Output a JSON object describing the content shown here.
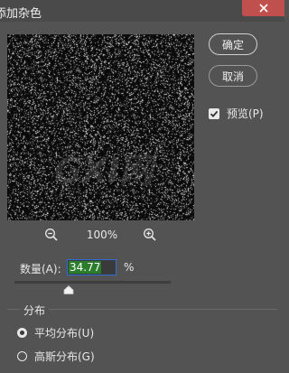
{
  "title": "添加杂色",
  "buttons": {
    "ok": "确定",
    "cancel": "取消"
  },
  "preview_toggle": {
    "label": "预览(P)",
    "checked": true
  },
  "zoom": {
    "level": "100%"
  },
  "amount": {
    "label": "数量(A):",
    "value": "34.77",
    "unit": "%",
    "slider_fraction": 0.3477
  },
  "distribution": {
    "title": "分布",
    "options": [
      {
        "label": "平均分布(U)",
        "selected": true
      },
      {
        "label": "高斯分布(G)",
        "selected": false
      }
    ]
  },
  "watermark": "GXI网",
  "colors": {
    "dialog_bg": "#535353",
    "close_button": "#c0504d",
    "input_focus": "#2d6fd6",
    "selection": "#2a7d2a"
  }
}
